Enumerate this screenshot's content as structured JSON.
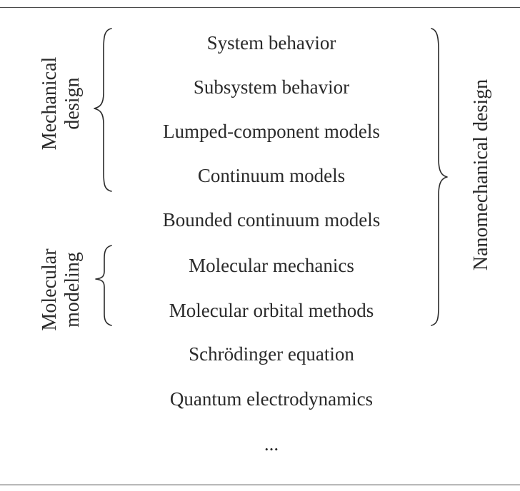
{
  "levels": [
    "System behavior",
    "Subsystem behavior",
    "Lumped-component models",
    "Continuum models",
    "Bounded continuum models",
    "Molecular mechanics",
    "Molecular orbital methods",
    "Schrödinger equation",
    "Quantum electrodynamics",
    "..."
  ],
  "groups": {
    "mechanical_design": {
      "line1": "Mechanical",
      "line2": "design"
    },
    "molecular_modeling": {
      "line1": "Molecular",
      "line2": "modeling"
    },
    "nanomechanical_design": {
      "label": "Nanomechanical design"
    }
  }
}
